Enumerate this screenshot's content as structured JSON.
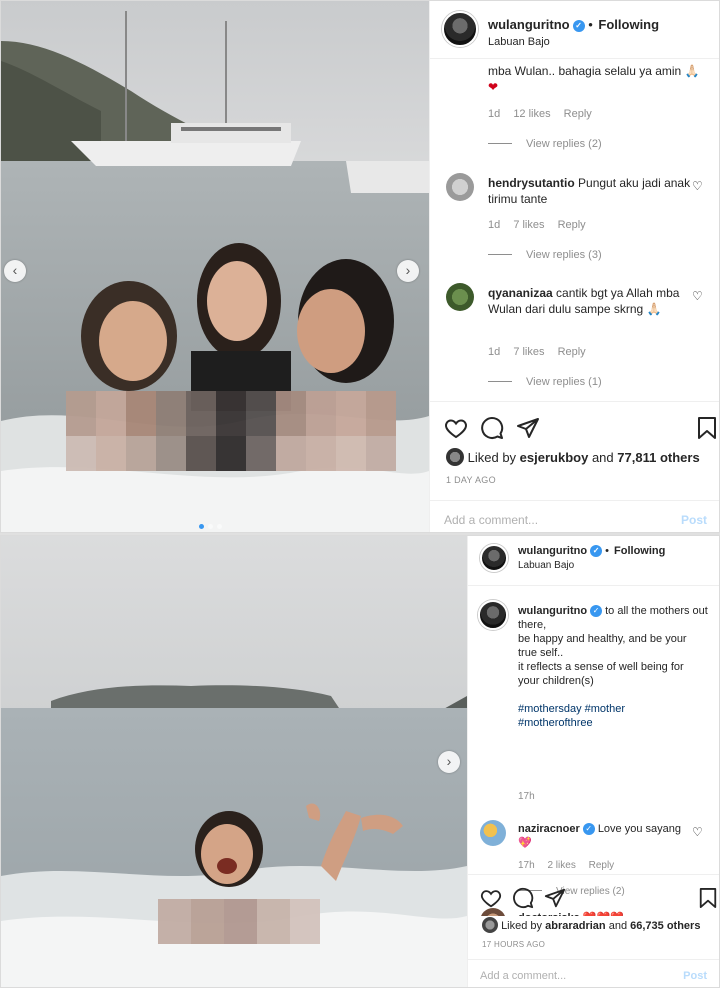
{
  "post1": {
    "username": "wulanguritno",
    "follow_label": "Following",
    "location": "Labuan Bajo",
    "comments": [
      {
        "text": "mba Wulan.. bahagia selalu ya amin",
        "emoji": "🙏🏻❤",
        "time": "1d",
        "likes": "12 likes",
        "reply": "Reply",
        "view_replies": "View replies (2)"
      },
      {
        "user": "hendrysutantio",
        "text": "Pungut aku jadi anak tirimu tante",
        "time": "1d",
        "likes": "7 likes",
        "reply": "Reply",
        "view_replies": "View replies (3)"
      },
      {
        "user": "qyananizaa",
        "text": "cantik bgt ya Allah mba Wulan dari dulu sampe skrng",
        "emoji": "🙏🏻",
        "time": "1d",
        "likes": "7 likes",
        "reply": "Reply",
        "view_replies": "View replies (1)"
      }
    ],
    "liked_by_user": "esjerukboy",
    "liked_by_others": "77,811 others",
    "liked_prefix": "Liked by",
    "liked_and": "and",
    "time_ago": "1 DAY AGO",
    "add_comment_placeholder": "Add a comment...",
    "post_label": "Post"
  },
  "post2": {
    "username": "wulanguritno",
    "follow_label": "Following",
    "location": "Labuan Bajo",
    "caption_lines": [
      "to all the mothers out there,",
      "be happy and healthy, and be your true self..",
      "it reflects a sense of well being for your children(s)"
    ],
    "hashtags": [
      "#mothersday",
      "#mother",
      "#motherofthree"
    ],
    "caption_time": "17h",
    "comments": [
      {
        "user": "naziracnoer",
        "text": "Love you sayang",
        "emoji": "💖",
        "time": "17h",
        "likes": "2 likes",
        "reply": "Reply",
        "view_replies": "View replies (2)"
      },
      {
        "user": "doctorsiska",
        "text": "❤️❤️❤️"
      }
    ],
    "liked_by_user": "abraradrian",
    "liked_by_others": "66,735 others",
    "liked_prefix": "Liked by",
    "liked_and": "and",
    "time_ago": "17 HOURS AGO",
    "add_comment_placeholder": "Add a comment...",
    "post_label": "Post"
  },
  "colors": {
    "verified": "#3897f0",
    "hashtag": "#003569",
    "muted": "#8e8e8e",
    "post_button": "#b9dcfc"
  },
  "icons": {
    "like": "heart-icon",
    "comment": "comment-bubble-icon",
    "share": "paper-plane-icon",
    "save": "bookmark-icon",
    "verified": "verified-badge-icon"
  }
}
